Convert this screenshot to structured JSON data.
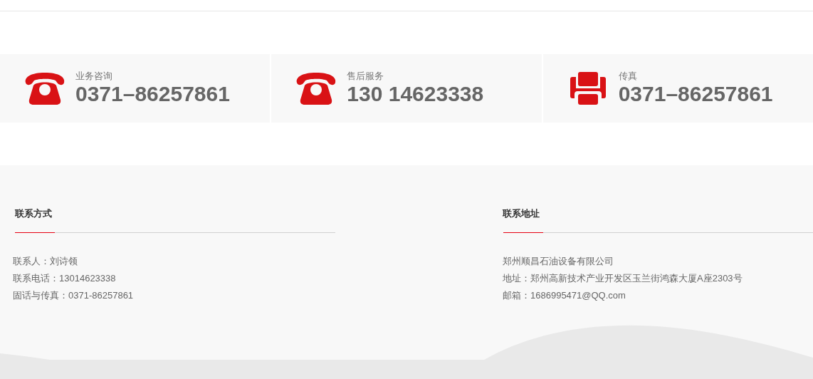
{
  "contact_strip": [
    {
      "kind": "phone",
      "label": "业务咨询",
      "number": "0371–86257861"
    },
    {
      "kind": "phone",
      "label": "售后服务",
      "number": "130 14623338"
    },
    {
      "kind": "fax",
      "label": "传真",
      "number": "0371–86257861"
    }
  ],
  "footer": {
    "sections": [
      {
        "title": "联系方式",
        "lines": [
          "联系人：刘诗领",
          "联系电话：13014623338",
          "固话与传真：0371-86257861"
        ]
      },
      {
        "title": "联系地址",
        "lines": [
          "郑州顺昌石油设备有限公司",
          "地址：郑州高新技术产业开发区玉兰街鸿森大厦A座2303号",
          "邮箱：1686995471@QQ.com"
        ]
      }
    ]
  }
}
